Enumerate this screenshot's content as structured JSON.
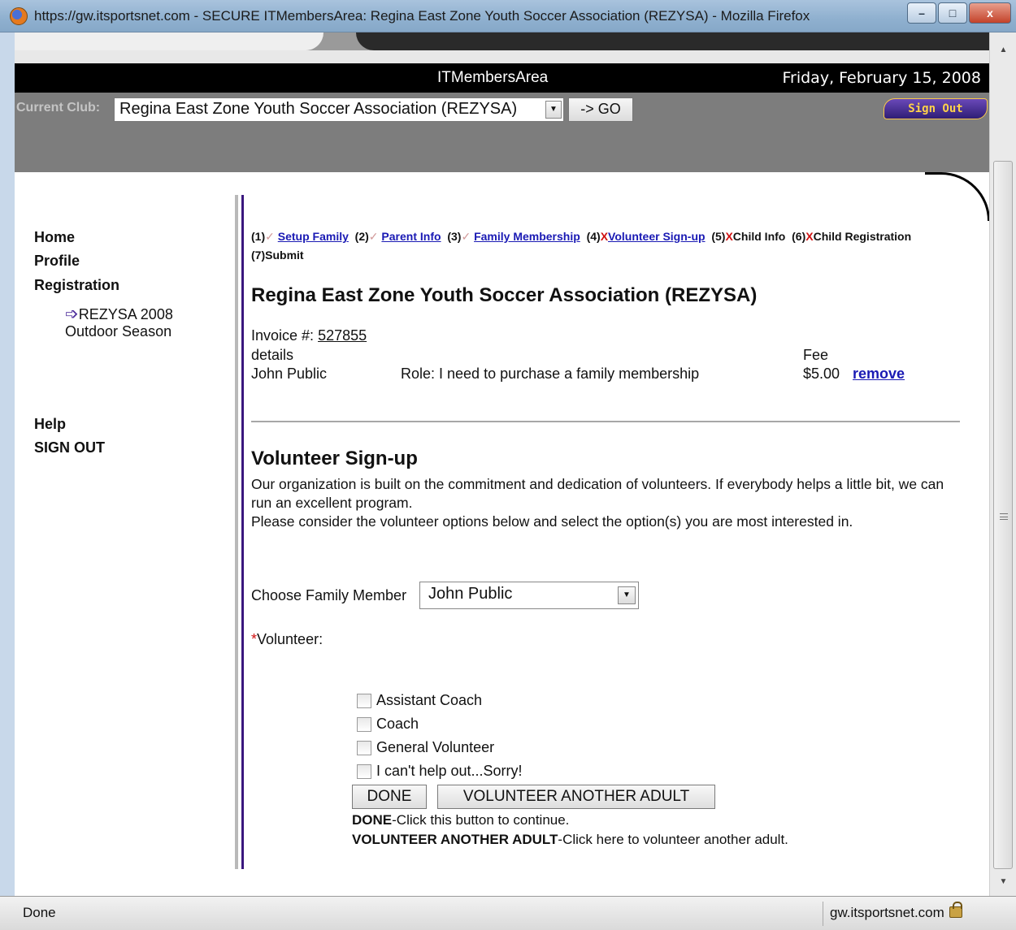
{
  "window": {
    "title": "https://gw.itsportsnet.com - SECURE ITMembersArea: Regina East Zone Youth Soccer Association (REZYSA) - Mozilla Firefox",
    "minimize": "–",
    "maximize": "□",
    "close": "x"
  },
  "header": {
    "app_name": "ITMembersArea",
    "date": "Friday, February 15, 2008",
    "club_label": "Current Club:",
    "club_selected": "Regina East Zone Youth Soccer Association (REZYSA)",
    "go_label": "-> GO",
    "signout_label": "Sign Out"
  },
  "nav": {
    "home": "Home",
    "profile": "Profile",
    "registration": "Registration",
    "season_line1": "REZYSA 2008",
    "season_line2": "Outdoor Season",
    "help": "Help",
    "signout": "SIGN OUT"
  },
  "steps": [
    {
      "num": "(1)",
      "label": "Setup Family",
      "state": "done"
    },
    {
      "num": "(2)",
      "label": "Parent Info",
      "state": "done"
    },
    {
      "num": "(3)",
      "label": "Family Membership",
      "state": "done"
    },
    {
      "num": "(4)",
      "label": "Volunteer Sign-up",
      "state": "current"
    },
    {
      "num": "(5)",
      "label": "Child Info",
      "state": "todo"
    },
    {
      "num": "(6)",
      "label": "Child Registration",
      "state": "todo"
    },
    {
      "num": "(7)",
      "label": "Submit",
      "state": "plain"
    }
  ],
  "main": {
    "club_title": "Regina East Zone Youth Soccer Association (REZYSA)",
    "invoice_label": "Invoice #:",
    "invoice_number": "527855",
    "details_label": "details",
    "fee_label": "Fee",
    "member_name": "John Public",
    "role_text": "Role: I need to purchase a family membership",
    "fee_amount": "$5.00",
    "remove_label": "remove",
    "section_title": "Volunteer Sign-up",
    "paragraph_1": "Our organization is built on the commitment and dedication of volunteers. If everybody helps a little bit, we can run an excellent program.",
    "paragraph_2": "Please consider the volunteer options below and select the option(s) you are most interested in.",
    "choose_member_label": "Choose Family Member",
    "choose_member_value": "John Public",
    "volunteer_required_mark": "*",
    "volunteer_label": "Volunteer:",
    "options": [
      "Assistant Coach",
      "Coach",
      "General Volunteer",
      "I can't help out...Sorry!"
    ],
    "done_label": "DONE",
    "volunteer_another_label": "VOLUNTEER ANOTHER ADULT",
    "help_done_bold": "DONE",
    "help_done_text": "-Click this button to continue.",
    "help_another_bold": "VOLUNTEER ANOTHER ADULT",
    "help_another_text": "-Click here to volunteer another adult."
  },
  "statusbar": {
    "status": "Done",
    "host": "gw.itsportsnet.com"
  }
}
